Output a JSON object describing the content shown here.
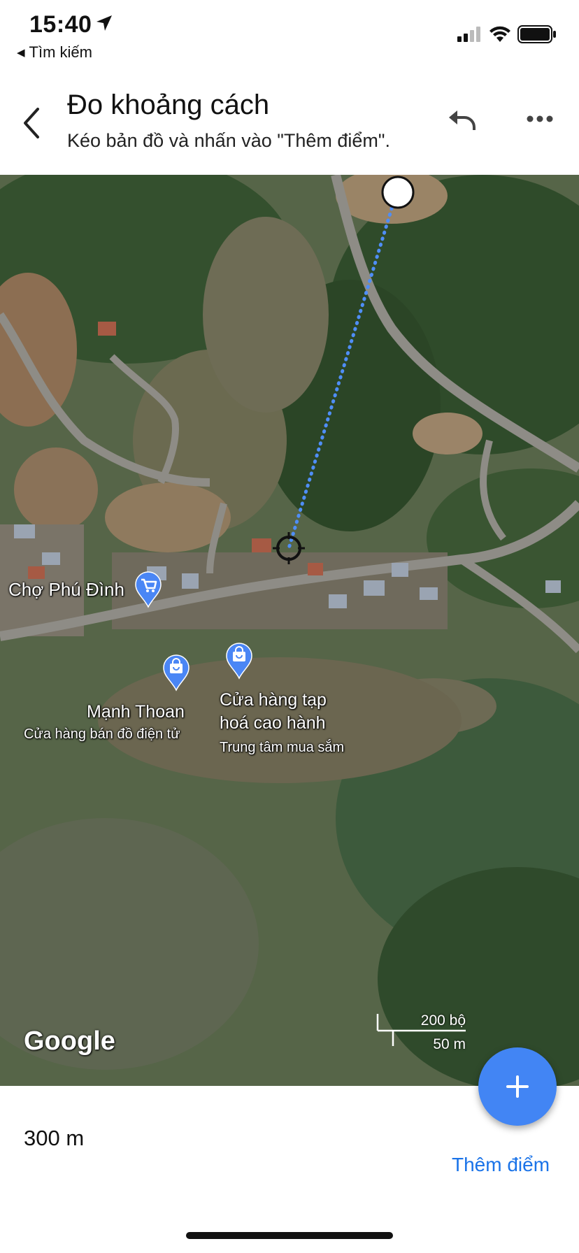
{
  "status_bar": {
    "time": "15:40",
    "back_app_label": "Tìm kiếm",
    "icons": [
      "location-arrow-icon",
      "cellular-signal-icon",
      "wifi-icon",
      "battery-icon"
    ]
  },
  "header": {
    "title": "Đo khoảng cách",
    "subtitle": "Kéo bản đồ và nhấn vào \"Thêm điểm\".",
    "icons": [
      "back-chevron-icon",
      "undo-icon",
      "more-options-icon"
    ]
  },
  "map": {
    "type": "satellite",
    "pois": [
      {
        "name": "Chợ Phú Đình",
        "category": "",
        "icon": "shopping-cart-pin-icon"
      },
      {
        "name": "Mạnh Thoan",
        "category": "Cửa hàng bán đồ điện tử",
        "icon": "shopping-bag-pin-icon"
      },
      {
        "name_line1": "Cửa hàng tạp",
        "name_line2": "hoá cao hành",
        "category": "Trung tâm mua sắm",
        "icon": "shopping-bag-pin-icon"
      }
    ],
    "attribution": "Google",
    "scale": {
      "imperial": "200 bộ",
      "metric": "50 m"
    },
    "measure_line_color": "#4285f4"
  },
  "fab": {
    "icon": "plus-icon",
    "color": "#4285f4"
  },
  "bottom": {
    "distance": "300 m",
    "add_point_label": "Thêm điểm",
    "accent": "#1a73e8"
  }
}
